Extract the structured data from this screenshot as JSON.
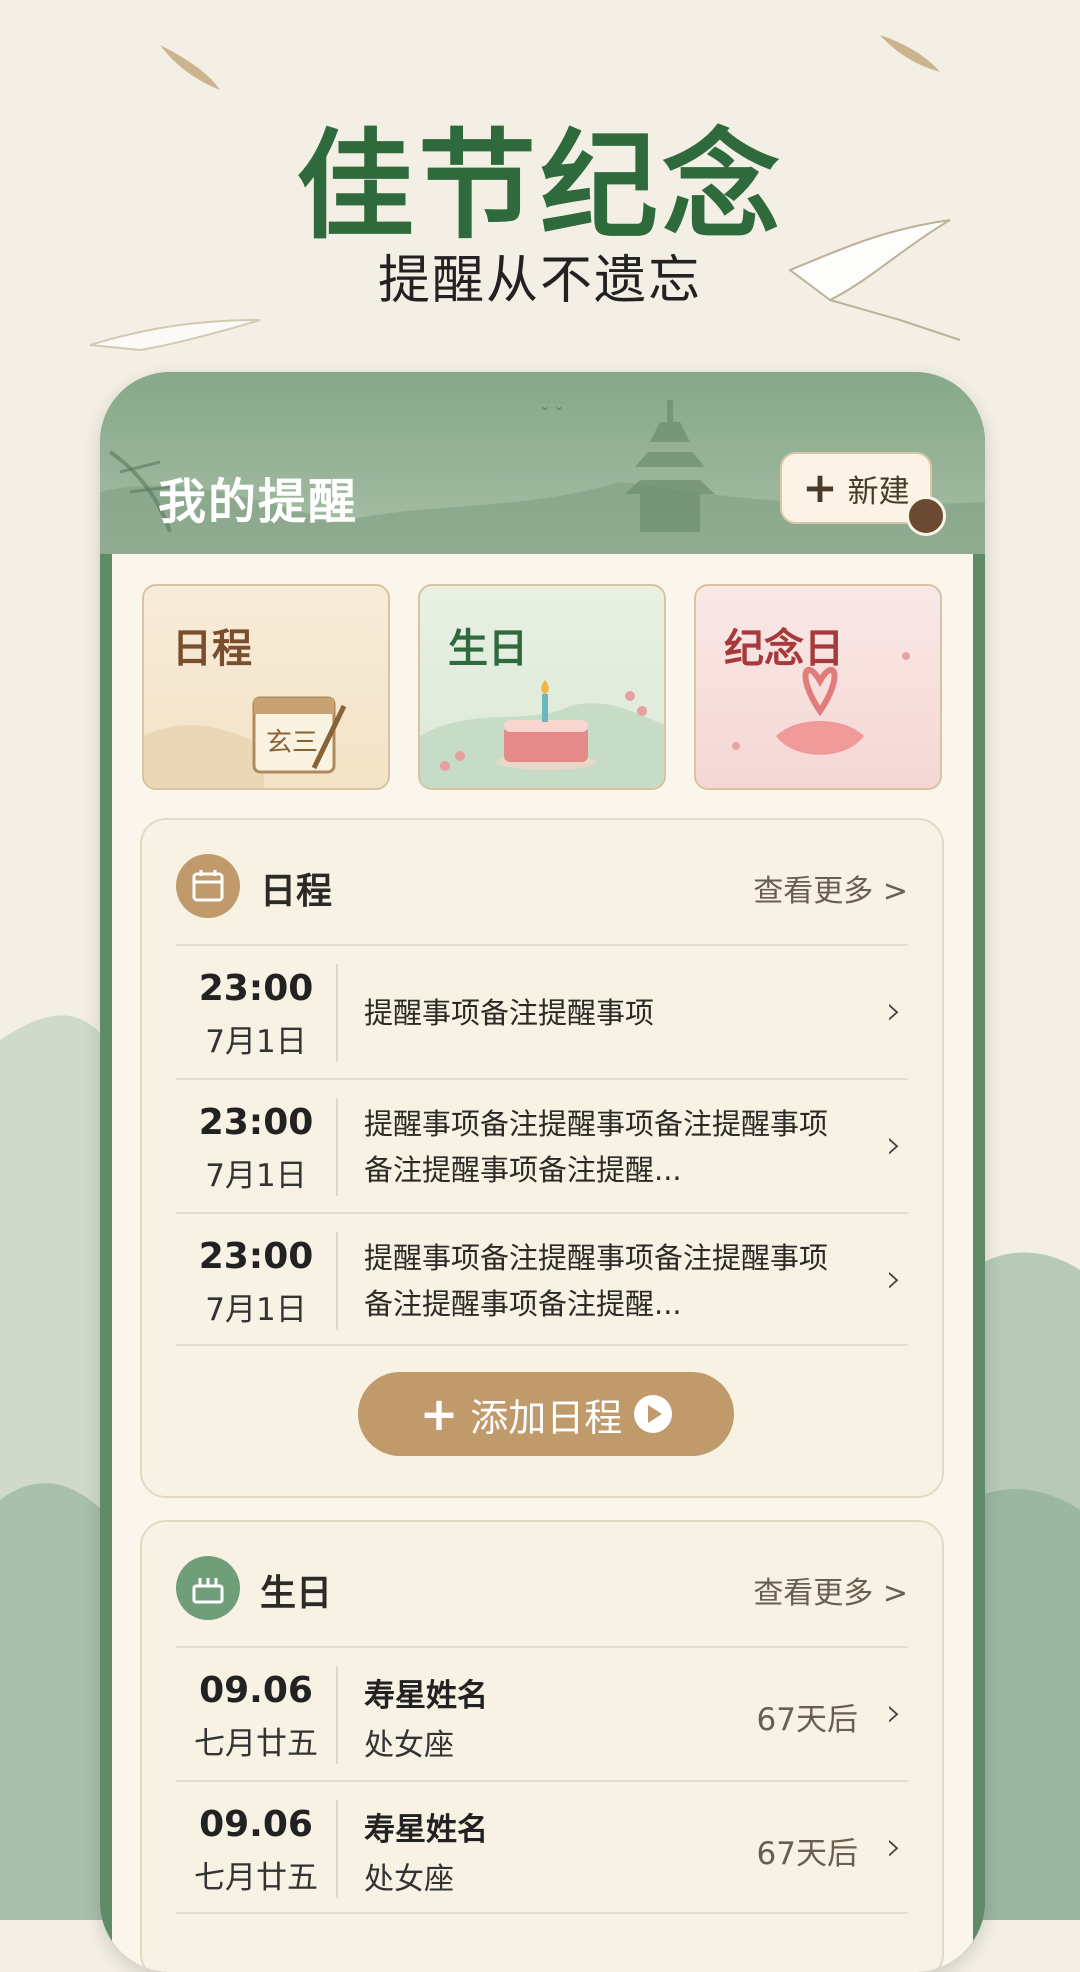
{
  "hero": {
    "title": "佳节纪念",
    "subtitle": "提醒从不遗忘"
  },
  "header": {
    "title": "我的提醒",
    "new_button": "新建"
  },
  "categories": [
    {
      "label": "日程",
      "color": "#7a4e2c"
    },
    {
      "label": "生日",
      "color": "#2f6a3d"
    },
    {
      "label": "纪念日",
      "color": "#a63a3a"
    }
  ],
  "schedule": {
    "title": "日程",
    "more": "查看更多 >",
    "items": [
      {
        "time": "23:00",
        "date": "7月1日",
        "note": "提醒事项备注提醒事项"
      },
      {
        "time": "23:00",
        "date": "7月1日",
        "note": "提醒事项备注提醒事项备注提醒事项备注提醒事项备注提醒..."
      },
      {
        "time": "23:00",
        "date": "7月1日",
        "note": "提醒事项备注提醒事项备注提醒事项备注提醒事项备注提醒..."
      }
    ],
    "add_button": "添加日程"
  },
  "birthday": {
    "title": "生日",
    "more": "查看更多 >",
    "items": [
      {
        "date": "09.06",
        "lunar": "七月廿五",
        "name": "寿星姓名",
        "sign": "处女座",
        "countdown": "67天后"
      },
      {
        "date": "09.06",
        "lunar": "七月廿五",
        "name": "寿星姓名",
        "sign": "处女座",
        "countdown": "67天后"
      }
    ]
  },
  "icons": {
    "chevron": "chevron-right-icon",
    "calendar": "calendar-icon",
    "cake": "cake-icon",
    "plus": "plus-icon",
    "play": "play-icon"
  },
  "colors": {
    "brand_green": "#2f6a3d",
    "frame_green": "#5f8b67",
    "accent_tan": "#c09a6b",
    "background": "#f3efe4"
  }
}
